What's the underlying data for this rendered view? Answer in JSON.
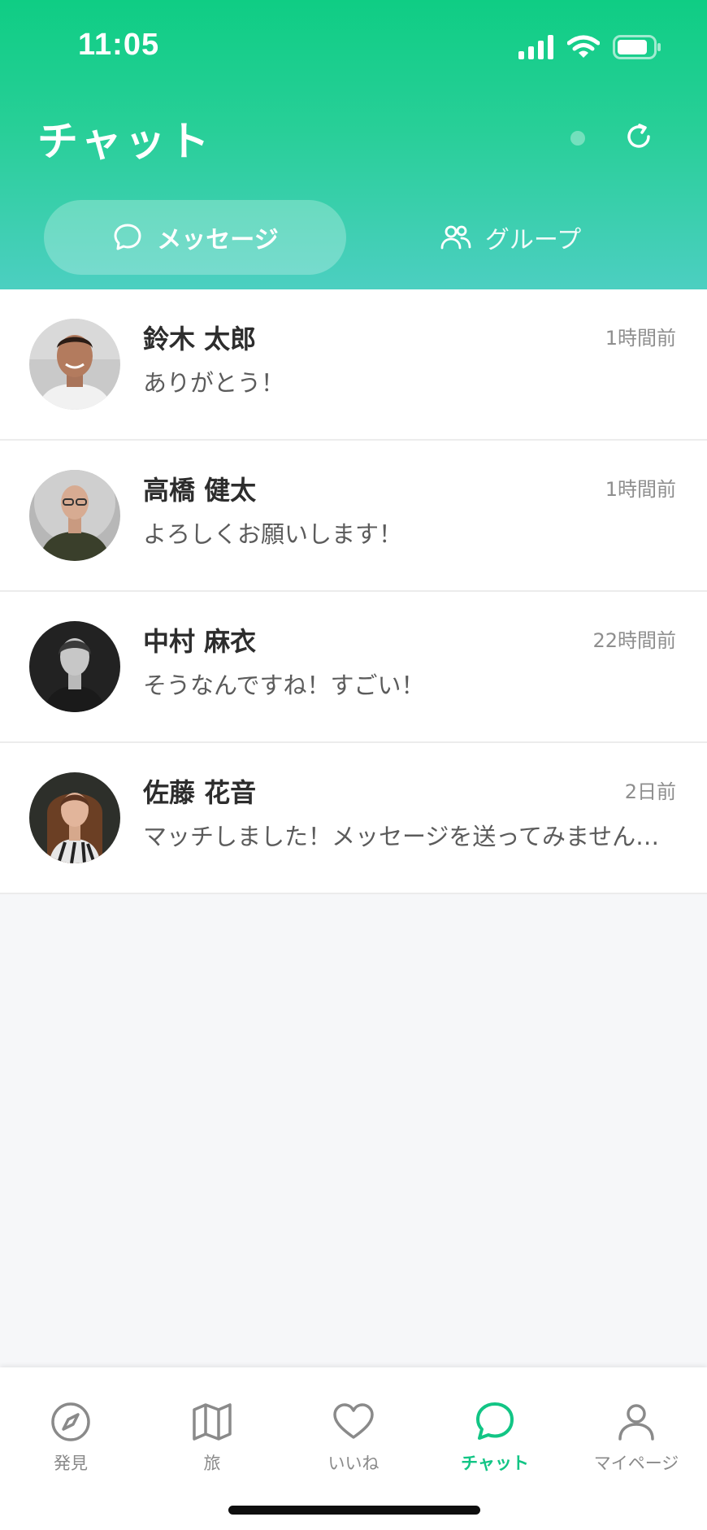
{
  "status_bar": {
    "time": "11:05"
  },
  "header": {
    "title": "チャット",
    "tabs": [
      {
        "label": "メッセージ",
        "icon": "chat-bubble-icon",
        "active": true
      },
      {
        "label": "グループ",
        "icon": "group-icon",
        "active": false
      }
    ]
  },
  "conversations": [
    {
      "name": "鈴木 太郎",
      "preview": "ありがとう！",
      "time": "1時間前",
      "avatar": "avatar-man-smiling"
    },
    {
      "name": "高橋 健太",
      "preview": "よろしくお願いします！",
      "time": "1時間前",
      "avatar": "avatar-bald-man-glasses"
    },
    {
      "name": "中村 麻衣",
      "preview": "そうなんですね！すごい！",
      "time": "22時間前",
      "avatar": "avatar-woman-bw"
    },
    {
      "name": "佐藤 花音",
      "preview": "マッチしました！メッセージを送ってみませんか？",
      "time": "2日前",
      "avatar": "avatar-woman-brown-hair"
    }
  ],
  "tabbar": {
    "items": [
      {
        "label": "発見",
        "icon": "compass-icon",
        "active": false
      },
      {
        "label": "旅",
        "icon": "map-icon",
        "active": false
      },
      {
        "label": "いいね",
        "icon": "heart-icon",
        "active": false
      },
      {
        "label": "チャット",
        "icon": "chat-icon",
        "active": true
      },
      {
        "label": "マイページ",
        "icon": "person-icon",
        "active": false
      }
    ]
  },
  "colors": {
    "accent": "#12c585",
    "header_top": "#0fcd84",
    "header_bottom": "#4ccfc1"
  }
}
